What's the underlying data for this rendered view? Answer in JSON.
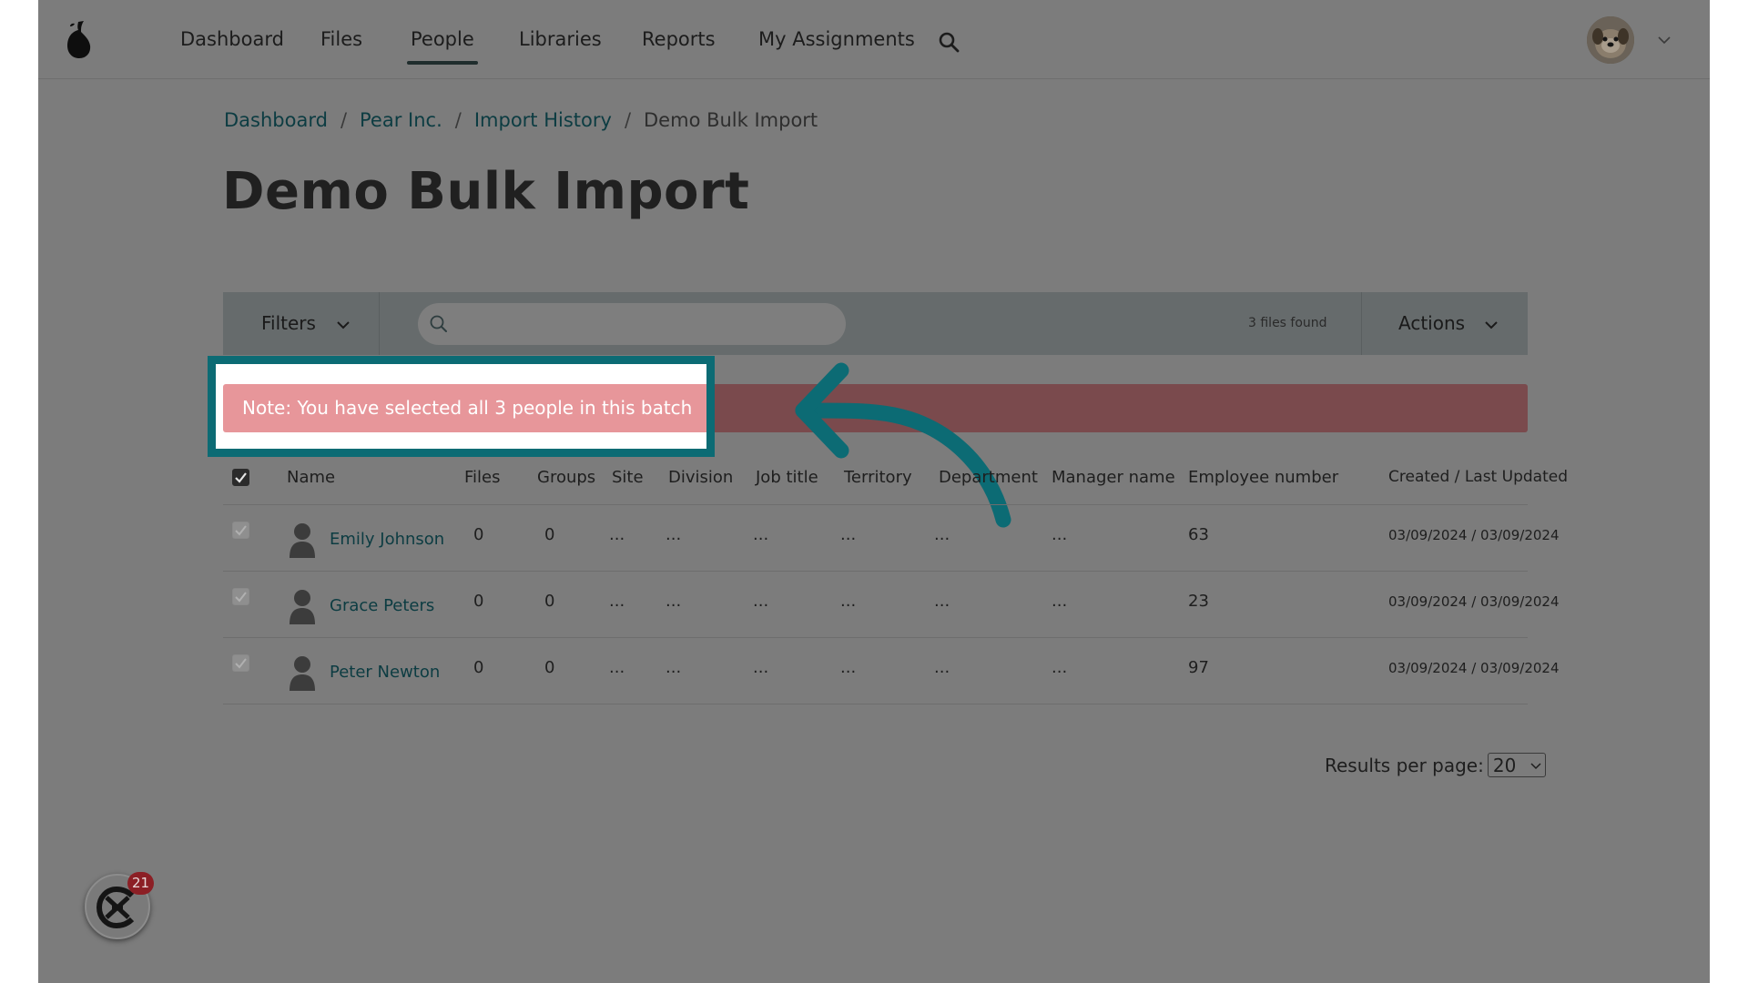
{
  "nav": {
    "items": [
      {
        "label": "Dashboard"
      },
      {
        "label": "Files"
      },
      {
        "label": "People",
        "active": true
      },
      {
        "label": "Libraries"
      },
      {
        "label": "Reports"
      },
      {
        "label": "My Assignments"
      }
    ]
  },
  "breadcrumb": {
    "items": [
      "Dashboard",
      "Pear Inc.",
      "Import History"
    ],
    "separator": "/",
    "current": "Demo Bulk Import"
  },
  "page": {
    "title": "Demo Bulk Import"
  },
  "toolbar": {
    "filters_label": "Filters",
    "search_value": "",
    "files_found": "3 files found",
    "actions_label": "Actions"
  },
  "note": {
    "text": "Note: You have selected all 3 people in this batch"
  },
  "table": {
    "columns": [
      "Name",
      "Files",
      "Groups",
      "Site",
      "Division",
      "Job title",
      "Territory",
      "Department",
      "Manager name",
      "Employee number",
      "Created / Last Updated"
    ],
    "rows": [
      {
        "name": "Emily Johnson",
        "files": "0",
        "groups": "0",
        "site": "...",
        "division": "...",
        "job_title": "...",
        "territory": "...",
        "department": "...",
        "manager": "...",
        "employee_number": "63",
        "dates": "03/09/2024 / 03/09/2024"
      },
      {
        "name": "Grace Peters",
        "files": "0",
        "groups": "0",
        "site": "...",
        "division": "...",
        "job_title": "...",
        "territory": "...",
        "department": "...",
        "manager": "...",
        "employee_number": "23",
        "dates": "03/09/2024 / 03/09/2024"
      },
      {
        "name": "Peter Newton",
        "files": "0",
        "groups": "0",
        "site": "...",
        "division": "...",
        "job_title": "...",
        "territory": "...",
        "department": "...",
        "manager": "...",
        "employee_number": "97",
        "dates": "03/09/2024 / 03/09/2024"
      }
    ]
  },
  "pagination": {
    "results_label": "Results per page:",
    "results_value": "20"
  },
  "chat": {
    "badge_count": "21"
  },
  "colors": {
    "overlay": "#7c7c7c",
    "highlight_border": "#0c6b74",
    "note_banner": "#e7969a",
    "link": "#0c3c42",
    "badge": "#8c1f25"
  }
}
